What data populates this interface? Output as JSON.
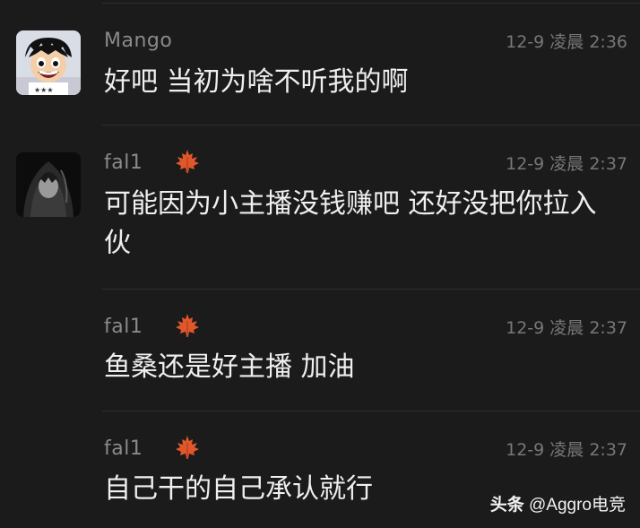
{
  "colors": {
    "background": "#1b1b1b",
    "name": "#8a8a8a",
    "time": "#777777",
    "text": "#efefef",
    "leaf": "#e0572b"
  },
  "comments": [
    {
      "user": "Mango",
      "time": "12-9 凌晨 2:36",
      "text": "好吧 当初为啥不听我的啊",
      "avatar": "luffy-avatar",
      "badge": false
    },
    {
      "user": "fal1",
      "time": "12-9 凌晨 2:37",
      "text": "可能因为小主播没钱赚吧 还好没把你拉入伙",
      "avatar": "hooded-figure-avatar",
      "badge": true
    },
    {
      "user": "fal1",
      "time": "12-9 凌晨 2:37",
      "text": "鱼桑还是好主播 加油",
      "avatar": null,
      "badge": true
    },
    {
      "user": "fal1",
      "time": "12-9 凌晨 2:37",
      "text": "自己干的自己承认就行",
      "avatar": null,
      "badge": true
    }
  ],
  "watermark": {
    "brand": "头条",
    "handle": "@Aggro电竞"
  }
}
